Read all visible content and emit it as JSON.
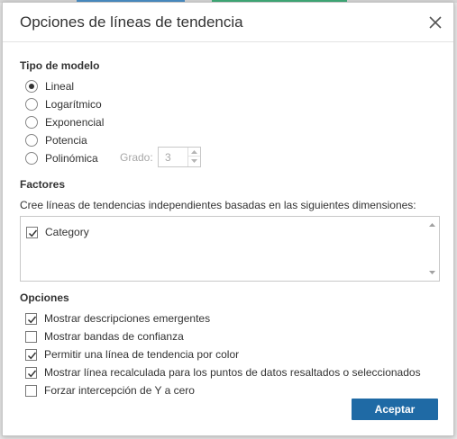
{
  "dialog": {
    "title": "Opciones de líneas de tendencia",
    "close_icon": "close-icon"
  },
  "model_type": {
    "label": "Tipo de modelo",
    "options": [
      {
        "label": "Lineal",
        "selected": true
      },
      {
        "label": "Logarítmico",
        "selected": false
      },
      {
        "label": "Exponencial",
        "selected": false
      },
      {
        "label": "Potencia",
        "selected": false
      },
      {
        "label": "Polinómica",
        "selected": false
      }
    ],
    "degree": {
      "label": "Grado:",
      "value": "3",
      "enabled": false
    }
  },
  "factors": {
    "label": "Factores",
    "description": "Cree líneas de tendencias independientes basadas en las siguientes dimensiones:",
    "items": [
      {
        "label": "Category",
        "checked": true
      }
    ]
  },
  "options": {
    "label": "Opciones",
    "items": [
      {
        "label": "Mostrar descripciones emergentes",
        "checked": true
      },
      {
        "label": "Mostrar bandas de confianza",
        "checked": false
      },
      {
        "label": "Permitir una línea de tendencia por color",
        "checked": true
      },
      {
        "label": "Mostrar línea recalculada para los puntos de datos resaltados o seleccionados",
        "checked": true
      },
      {
        "label": "Forzar intercepción de Y a cero",
        "checked": false
      }
    ]
  },
  "footer": {
    "accept_label": "Aceptar"
  },
  "colors": {
    "accent": "#1f6aa5",
    "text": "#333333",
    "disabled": "#a8a8a8"
  }
}
